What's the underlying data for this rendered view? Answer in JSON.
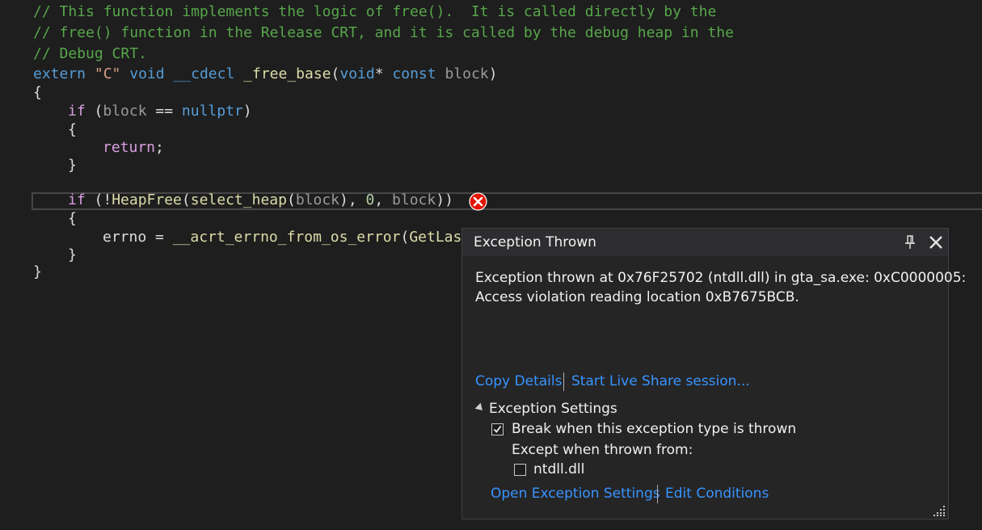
{
  "code": {
    "line1_comment": "// This function implements the logic of free().  It is called directly by the",
    "line2_comment": "// free() function in the Release CRT, and it is called by the debug heap in the",
    "line3_comment": "// Debug CRT.",
    "line4": {
      "kw_extern": "extern",
      "str_c": "\"C\"",
      "kw_void": "void",
      "kw_cdecl": "__cdecl",
      "fn_name": "_free_base",
      "paren_open": "(",
      "kw_void2": "void",
      "star": "*",
      "kw_const": "const",
      "param": "block",
      "paren_close": ")"
    },
    "brace_open": "{",
    "line6": {
      "kw_if": "if",
      "p1": " (",
      "param": "block",
      "op": " == ",
      "kw_nullptr": "nullptr",
      "p2": ")"
    },
    "inner_brace_open": "{",
    "line8": {
      "kw_return": "return",
      "semi": ";"
    },
    "inner_brace_close": "}",
    "line11": {
      "kw_if": "if",
      "p1": " (!",
      "fn_heapfree": "HeapFree",
      "p2": "(",
      "fn_select_heap": "select_heap",
      "p3": "(",
      "param1": "block",
      "p4": "), ",
      "num": "0",
      "p5": ", ",
      "param2": "block",
      "p6": "))"
    },
    "inner_brace_open2": "{",
    "line13": {
      "var": "errno",
      "op": " = ",
      "fn": "__acrt_errno_from_os_error",
      "p1": "(",
      "fn2": "GetLast"
    },
    "inner_brace_close2": "}",
    "brace_close": "}"
  },
  "popup": {
    "title": "Exception Thrown",
    "pin_icon": "pin-icon",
    "close_icon": "close-icon",
    "message_line1": "Exception thrown at 0x76F25702 (ntdll.dll) in gta_sa.exe: 0xC0000005:",
    "message_line2": "Access violation reading location 0xB7675BCB.",
    "copy_details": "Copy Details",
    "live_share": "Start Live Share session...",
    "settings_header": "Exception Settings",
    "break_when_label": "Break when this exception type is thrown",
    "break_when_checked": true,
    "except_when_label": "Except when thrown from:",
    "ntdll_label": "ntdll.dll",
    "ntdll_checked": false,
    "open_settings": "Open Exception Settings",
    "edit_conditions": "Edit Conditions"
  },
  "colors": {
    "background": "#1e1e1e",
    "comment": "#57a64a",
    "keyword": "#569cd6",
    "control": "#d8a0df",
    "string": "#d69d85",
    "function": "#dcdcaa",
    "link": "#3794ff",
    "error": "#e51400"
  }
}
